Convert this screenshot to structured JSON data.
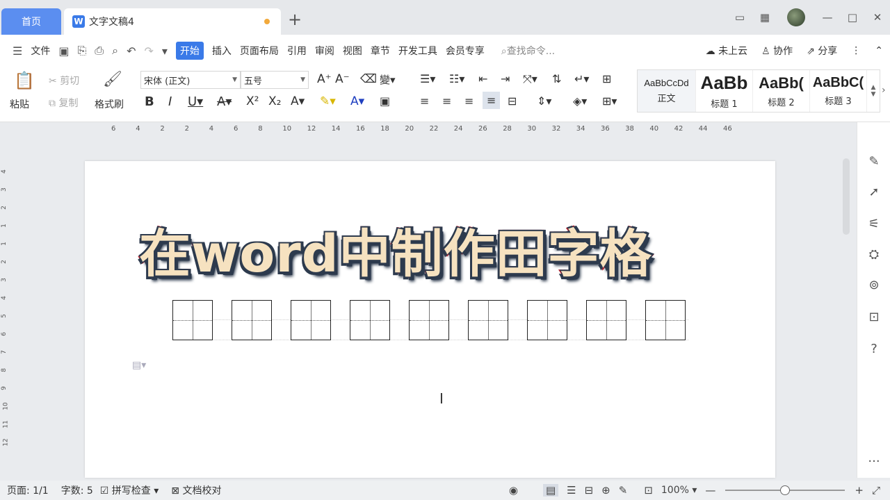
{
  "tabs": {
    "home": "首页",
    "doc_title": "文字文稿4",
    "new_tab": "+"
  },
  "menu": {
    "file": "文件",
    "items": [
      "开始",
      "插入",
      "页面布局",
      "引用",
      "审阅",
      "视图",
      "章节",
      "开发工具",
      "会员专享"
    ],
    "active": "开始",
    "search_placeholder": "查找命令...",
    "cloud": "未上云",
    "collab": "协作",
    "share": "分享"
  },
  "ribbon": {
    "paste": "粘贴",
    "cut": "剪切",
    "copy": "复制",
    "format_painter": "格式刷",
    "font_name": "宋体 (正文)",
    "font_size": "五号",
    "styles": [
      {
        "sample": "AaBbCcDd",
        "label": "正文"
      },
      {
        "sample": "AaBb",
        "label": "标题 1"
      },
      {
        "sample": "AaBb(",
        "label": "标题 2"
      },
      {
        "sample": "AaBbC(",
        "label": "标题 3"
      }
    ]
  },
  "ruler": {
    "h_ticks": [
      "6",
      "4",
      "2",
      "2",
      "4",
      "6",
      "8",
      "10",
      "12",
      "14",
      "16",
      "18",
      "20",
      "22",
      "24",
      "26",
      "28",
      "30",
      "32",
      "34",
      "36",
      "38",
      "40",
      "42",
      "44",
      "46"
    ],
    "v_ticks": [
      "4",
      "3",
      "2",
      "1",
      "1",
      "2",
      "3",
      "4",
      "5",
      "6",
      "7",
      "8",
      "9",
      "10",
      "11",
      "12"
    ]
  },
  "document": {
    "headline": "在word中制作田字格",
    "grid_count": 9
  },
  "status": {
    "page": "页面: 1/1",
    "words": "字数: 5",
    "spell_check": "拼写检查",
    "proofread": "文档校对",
    "zoom": "100%",
    "zoom_level": 0.5
  },
  "colors": {
    "accent": "#3a7ae8",
    "home_tab": "#5b8ef0",
    "headline_fill": "#f6e2c0",
    "headline_stroke": "#b61e2a",
    "headline_shadow": "#2d3a4d"
  }
}
